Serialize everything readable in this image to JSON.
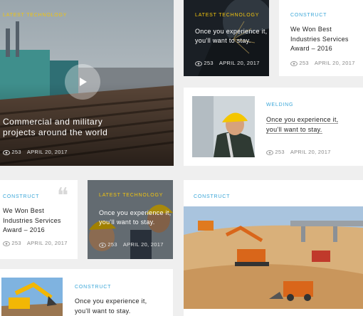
{
  "cards": {
    "hero": {
      "category": "LATEST TECHNOLOGY",
      "title_line1": "Commercial and military",
      "title_line2": "projects around the world",
      "views": "253",
      "date": "APRIL 20, 2017",
      "play_icon": "play-icon"
    },
    "tech_small_top": {
      "category": "LATEST TECHNOLOGY",
      "title_line1": "Once you experience it,",
      "title_line2": "you'll want to stay.",
      "views": "253",
      "date": "APRIL 20, 2017"
    },
    "construct_award_top": {
      "category": "CONSTRUCT",
      "title_line1": "We Won Best",
      "title_line2": "Industries Services",
      "title_line3": "Award – 2016",
      "views": "253",
      "date": "APRIL 20, 2017"
    },
    "welding": {
      "category": "WELDING",
      "title_line1": "Once you experience it,",
      "title_line2": "you'll want to stay.",
      "views": "253",
      "date": "APRIL 20, 2017"
    },
    "construct_award_left": {
      "category": "CONSTRUCT",
      "title_line1": "We Won Best",
      "title_line2": "Industries Services",
      "title_line3": "Award – 2016",
      "views": "253",
      "date": "APRIL 20, 2017"
    },
    "tech_small_mid": {
      "category": "LATEST TECHNOLOGY",
      "title_line1": "Once you experience it,",
      "title_line2": "you'll want to stay.",
      "views": "253",
      "date": "APRIL 20, 2017"
    },
    "construct_big": {
      "category": "CONSTRUCT"
    },
    "construct_bottom": {
      "category": "CONSTRUCT",
      "title_line1": "Once you experience it,",
      "title_line2": "you'll want to stay."
    }
  },
  "colors": {
    "yellow_accent": "#f1c40f",
    "blue_accent": "#3aa6d8"
  },
  "icons": [
    "eye-icon",
    "quote-icon",
    "play-icon"
  ]
}
